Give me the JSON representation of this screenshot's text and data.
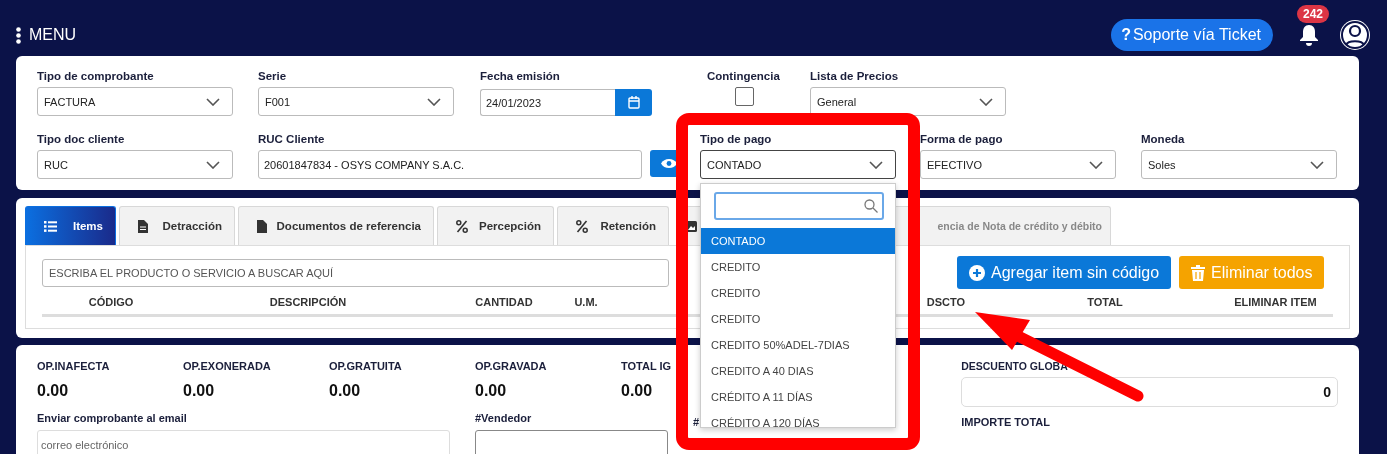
{
  "header": {
    "menu_label": "MENU",
    "help_glyph": "?",
    "support_button": "Soporte vía Ticket",
    "notification_count": "242"
  },
  "form": {
    "fields": [
      {
        "kind": "select",
        "label": "Tipo de comprobante",
        "value": "FACTURA"
      },
      {
        "kind": "select",
        "label": "Serie",
        "value": "F001"
      },
      {
        "kind": "date",
        "label": "Fecha emisión",
        "value": "24/01/2023"
      },
      {
        "kind": "checkbox",
        "label": "Contingencia",
        "checked": false
      },
      {
        "kind": "select",
        "label": "Lista de Precios",
        "value": "General"
      },
      {
        "kind": "select",
        "label": "Tipo doc cliente",
        "value": "RUC"
      },
      {
        "kind": "lookup",
        "label": "RUC Cliente",
        "value": "20601847834 - OSYS COMPANY S.A.C."
      },
      {
        "kind": "select",
        "label": "Tipo de pago",
        "value": "CONTADO",
        "open": true
      },
      {
        "kind": "select",
        "label": "Forma de pago",
        "value": "EFECTIVO"
      },
      {
        "kind": "select",
        "label": "Moneda",
        "value": "Soles"
      }
    ]
  },
  "tabs": [
    {
      "label": "Items",
      "kind": "list",
      "selected": true
    },
    {
      "label": "Detracción",
      "kind": "lines",
      "selected": false
    },
    {
      "label": "Documentos de referencia",
      "kind": "plain",
      "selected": false
    },
    {
      "label": "Percepción",
      "kind": "percent",
      "selected": false
    },
    {
      "label": "Retención",
      "kind": "percent",
      "selected": false
    },
    {
      "label": "encia de Nota de crédito y débito",
      "kind": "image",
      "selected": false
    }
  ],
  "items": {
    "search_placeholder": "ESCRIBA EL PRODUCTO O SERVICIO A BUSCAR AQUÍ",
    "add_button": "Agregar item sin código",
    "delete_button": "Eliminar todos",
    "columns": [
      "CÓDIGO",
      "DESCRIPCIÓN",
      "CANTIDAD",
      "U.M.",
      "",
      "DSCTO",
      "TOTAL",
      "ELIMINAR ITEM"
    ]
  },
  "totals": [
    {
      "label": "OP.INAFECTA",
      "value": "0.00"
    },
    {
      "label": "OP.EXONERADA",
      "value": "0.00"
    },
    {
      "label": "OP.GRATUITA",
      "value": "0.00"
    },
    {
      "label": "OP.GRAVADA",
      "value": "0.00"
    },
    {
      "label": "TOTAL IG",
      "value": "0.00"
    }
  ],
  "email": {
    "label": "Enviar comprobante al email",
    "placeholder": "correo electrónico"
  },
  "seller": {
    "label": "#Vendedor"
  },
  "extra_label": "#",
  "discount": {
    "label": "DESCUENTO GLOBA",
    "value": "0"
  },
  "total_label": "IMPORTE TOTAL",
  "dropdown_open": true,
  "dropdown": {
    "options": [
      {
        "label": "CONTADO",
        "selected": true
      },
      {
        "label": "CREDITO",
        "selected": false
      },
      {
        "label": "CREDITO",
        "selected": false
      },
      {
        "label": "CREDITO",
        "selected": false
      },
      {
        "label": "CREDITO 50%ADEL-7DIAS",
        "selected": false
      },
      {
        "label": "CREDITO A 40 DIAS",
        "selected": false
      },
      {
        "label": "CRÉDITO A 11 DÍAS",
        "selected": false
      },
      {
        "label": "CRÉDITO A 120 DÍAS",
        "selected": false
      }
    ]
  }
}
